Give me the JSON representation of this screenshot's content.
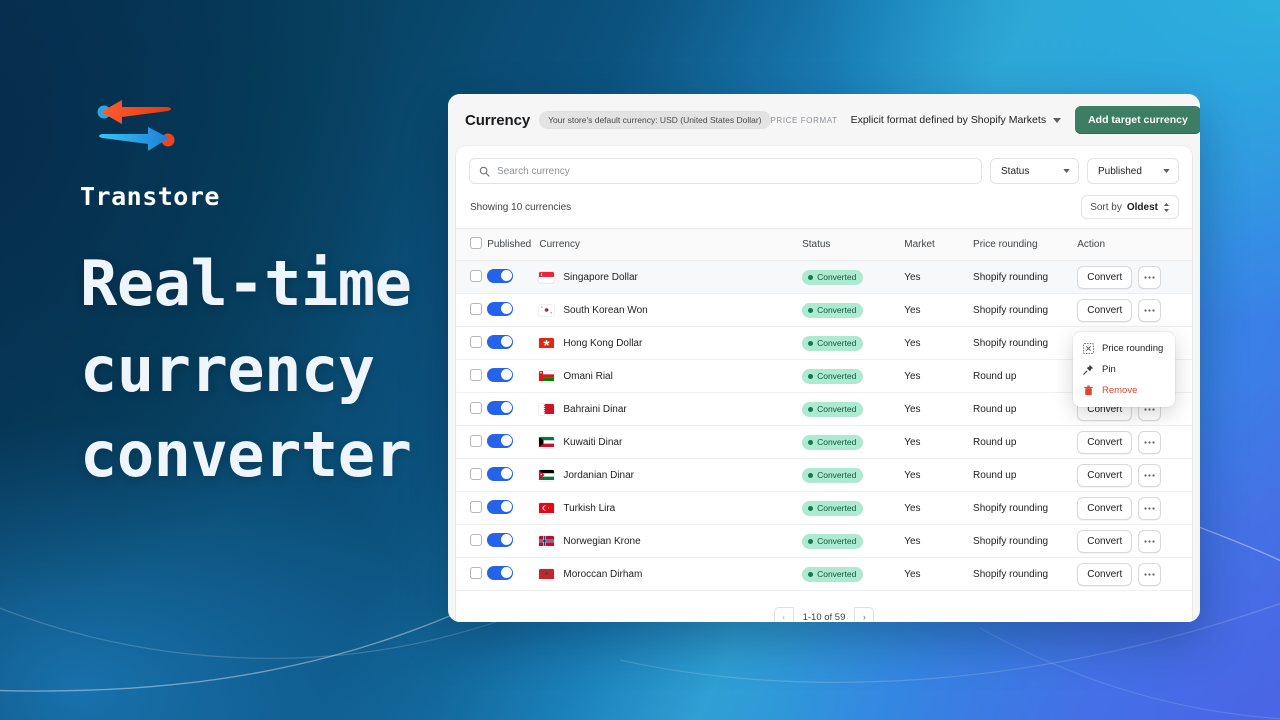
{
  "promo": {
    "logo_text": "Transtore",
    "headline_lines": [
      "Real-time",
      "currency",
      "converter"
    ],
    "logo_icon": "two-way-arrows-icon",
    "accent_red": "#ef4424",
    "accent_blue": "#2aa8e0"
  },
  "app": {
    "title": "Currency",
    "default_currency_pill": "Your store's default currency: USD (United States Dollar)",
    "price_format_label": "PRICE FORMAT",
    "price_format_value": "Explicit format defined by Shopify Markets",
    "add_button": "Add target currency",
    "primary_color": "#3c7d63"
  },
  "filters": {
    "search_placeholder": "Search currency",
    "search_value": "",
    "status_select": "Status",
    "published_select": "Published"
  },
  "list_meta": {
    "showing": "Showing 10 currencies",
    "sort_prefix": "Sort by",
    "sort_value": "Oldest"
  },
  "table": {
    "columns": [
      "Published",
      "Currency",
      "Status",
      "Market",
      "Price rounding",
      "Action"
    ],
    "convert_label": "Convert",
    "rows": [
      {
        "currency": "Singapore Dollar",
        "flag": "sg",
        "status": "Converted",
        "market": "Yes",
        "rounding": "Shopify rounding",
        "published": true,
        "highlight": true
      },
      {
        "currency": "South Korean Won",
        "flag": "kr",
        "status": "Converted",
        "market": "Yes",
        "rounding": "Shopify rounding",
        "published": true,
        "highlight": false
      },
      {
        "currency": "Hong Kong Dollar",
        "flag": "hk",
        "status": "Converted",
        "market": "Yes",
        "rounding": "Shopify rounding",
        "published": true,
        "highlight": false
      },
      {
        "currency": "Omani Rial",
        "flag": "om",
        "status": "Converted",
        "market": "Yes",
        "rounding": "Round up",
        "published": true,
        "highlight": false
      },
      {
        "currency": "Bahraini Dinar",
        "flag": "bh",
        "status": "Converted",
        "market": "Yes",
        "rounding": "Round up",
        "published": true,
        "highlight": false
      },
      {
        "currency": "Kuwaiti Dinar",
        "flag": "kw",
        "status": "Converted",
        "market": "Yes",
        "rounding": "Round up",
        "published": true,
        "highlight": false
      },
      {
        "currency": "Jordanian Dinar",
        "flag": "jo",
        "status": "Converted",
        "market": "Yes",
        "rounding": "Round up",
        "published": true,
        "highlight": false
      },
      {
        "currency": "Turkish Lira",
        "flag": "tr",
        "status": "Converted",
        "market": "Yes",
        "rounding": "Shopify rounding",
        "published": true,
        "highlight": false
      },
      {
        "currency": "Norwegian Krone",
        "flag": "no",
        "status": "Converted",
        "market": "Yes",
        "rounding": "Shopify rounding",
        "published": true,
        "highlight": false
      },
      {
        "currency": "Moroccan Dirham",
        "flag": "ma",
        "status": "Converted",
        "market": "Yes",
        "rounding": "Shopify rounding",
        "published": true,
        "highlight": false
      }
    ]
  },
  "context_menu": {
    "items": [
      {
        "label": "Price rounding",
        "icon": "price-rounding-icon",
        "danger": false
      },
      {
        "label": "Pin",
        "icon": "pin-icon",
        "danger": false
      },
      {
        "label": "Remove",
        "icon": "trash-icon",
        "danger": true
      }
    ]
  },
  "pagination": {
    "range": "1-10 of 59",
    "prev": "‹",
    "next": "›"
  }
}
